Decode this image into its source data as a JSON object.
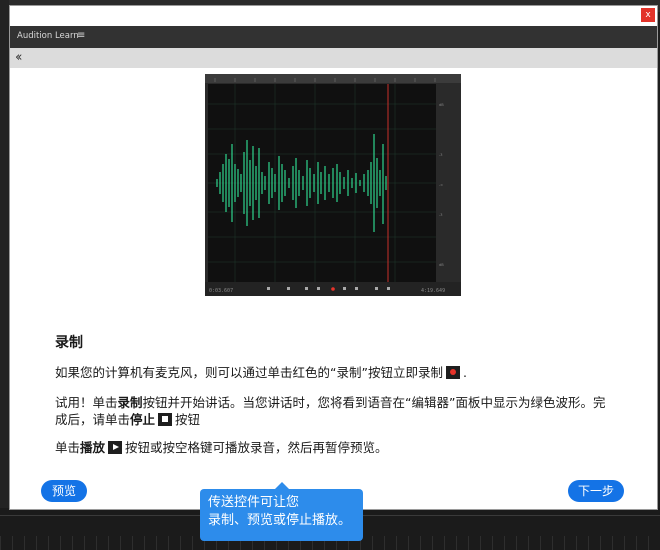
{
  "dialog": {
    "close_label": "x",
    "panel_title": "Audition Learn",
    "panel_menu_icon": "menu-icon",
    "back_icon": "double-chevron-left-icon"
  },
  "content": {
    "heading": "录制",
    "p1_text": "如果您的计算机有麦克风，则可以通过单击红色的“录制”按钮立即录制",
    "p1_end": ".",
    "p2_a": "试用！单击",
    "p2_record": "录制",
    "p2_b": "按钮并开始讲话。当您讲话时，您将看到语音在“编辑器”面板中显示为绿色波形。完成后，请单击",
    "p2_stop": "停止",
    "p2_c": "按钮",
    "p3_a": "单击",
    "p3_play": "播放",
    "p3_b": "按钮或按空格键可播放录音，然后再暂停预览。"
  },
  "buttons": {
    "preview": "预览",
    "next": "下一步"
  },
  "tooltip": {
    "line1": "传送控件可让您",
    "line2": "录制、预览或停止播放。"
  },
  "waveform": {
    "time_label": "0:03.607",
    "end_label": "4:19.649",
    "colors": {
      "wave": "#2fd58e",
      "playhead": "#c8302a",
      "bg": "#121212"
    }
  }
}
